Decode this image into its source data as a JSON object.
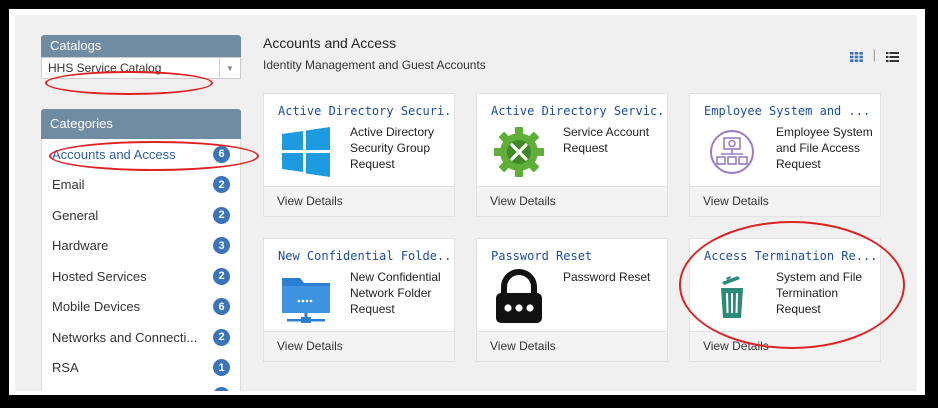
{
  "catalogs": {
    "header": "Catalogs",
    "selected": "HHS Service Catalog"
  },
  "categories": {
    "header": "Categories",
    "items": [
      {
        "label": "Accounts and Access",
        "count": "6"
      },
      {
        "label": "Email",
        "count": "2"
      },
      {
        "label": "General",
        "count": "2"
      },
      {
        "label": "Hardware",
        "count": "3"
      },
      {
        "label": "Hosted Services",
        "count": "2"
      },
      {
        "label": "Mobile Devices",
        "count": "6"
      },
      {
        "label": "Networks and Connecti...",
        "count": "2"
      },
      {
        "label": "RSA",
        "count": "1"
      }
    ]
  },
  "main": {
    "title": "Accounts and Access",
    "subtitle": "Identity Management and Guest Accounts",
    "cards": [
      {
        "title": "Active Directory Securi...",
        "desc": "Active Directory Security Group Request",
        "action": "View Details",
        "icon": "windows-logo-icon"
      },
      {
        "title": "Active Directory Servic...",
        "desc": "Service Account Request",
        "action": "View Details",
        "icon": "wrench-gear-icon"
      },
      {
        "title": "Employee System and ...",
        "desc": "Employee System and File Access Request",
        "action": "View Details",
        "icon": "folder-tree-icon"
      },
      {
        "title": "New Confidential Folde...",
        "desc": "New Confidential Network Folder Request",
        "action": "View Details",
        "icon": "network-folder-icon"
      },
      {
        "title": "Password Reset",
        "desc": "Password Reset",
        "action": "View Details",
        "icon": "padlock-icon"
      },
      {
        "title": "Access Termination Re...",
        "desc": "System and File Termination Request",
        "action": "View Details",
        "icon": "trash-icon"
      }
    ],
    "view_separator": "|"
  },
  "colors": {
    "accent": "#3b74b8",
    "header": "#6f8ca3",
    "annotation": "#dd2222"
  }
}
